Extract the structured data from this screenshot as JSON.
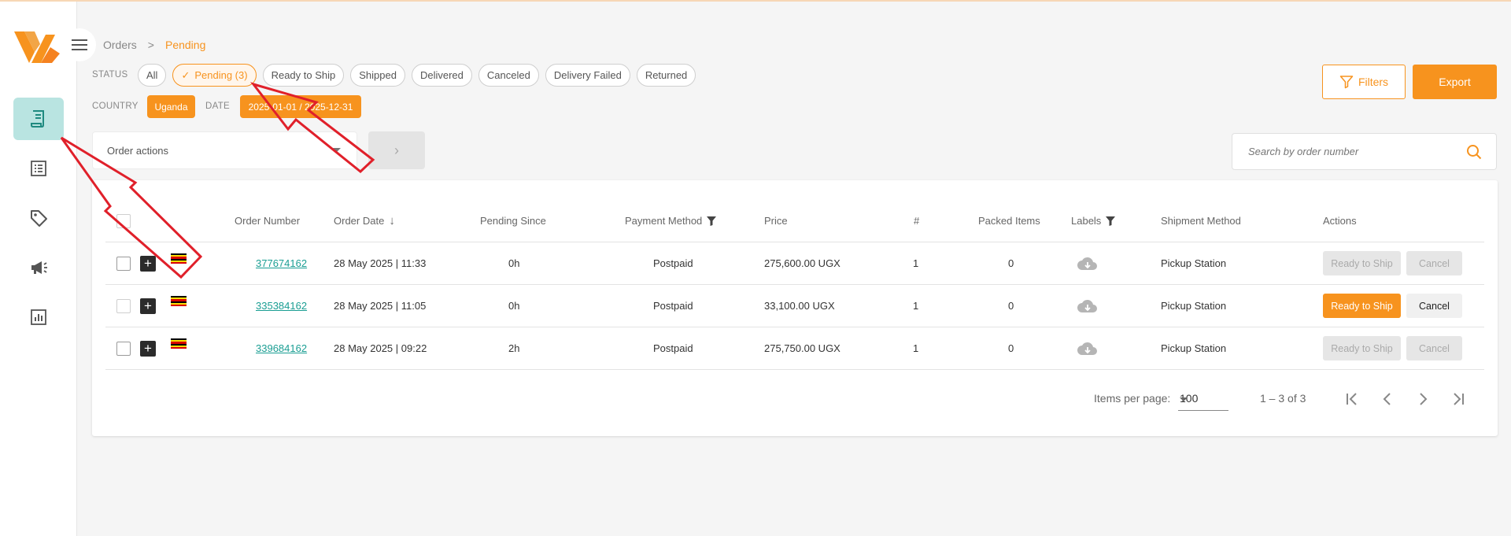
{
  "breadcrumb": {
    "root": "Orders",
    "separator": ">",
    "current": "Pending"
  },
  "filters": {
    "status_label": "STATUS",
    "statuses": [
      {
        "label": "All",
        "selected": false
      },
      {
        "label": "Pending (3)",
        "selected": true
      },
      {
        "label": "Ready to Ship",
        "selected": false
      },
      {
        "label": "Shipped",
        "selected": false
      },
      {
        "label": "Delivered",
        "selected": false
      },
      {
        "label": "Canceled",
        "selected": false
      },
      {
        "label": "Delivery Failed",
        "selected": false
      },
      {
        "label": "Returned",
        "selected": false
      }
    ],
    "country_label": "COUNTRY",
    "country_value": "Uganda",
    "date_label": "DATE",
    "date_value": "2025-01-01 / 2025-12-31"
  },
  "toolbar": {
    "filters_label": "Filters",
    "export_label": "Export"
  },
  "order_actions": {
    "placeholder": "Order actions"
  },
  "search": {
    "placeholder": "Search by order number"
  },
  "table": {
    "headers": {
      "order_number": "Order Number",
      "order_date": "Order Date",
      "pending_since": "Pending Since",
      "payment_method": "Payment Method",
      "price": "Price",
      "count": "#",
      "packed_items": "Packed Items",
      "labels": "Labels",
      "shipment_method": "Shipment Method",
      "actions": "Actions"
    },
    "rows": [
      {
        "order_number": "377674162",
        "order_date": "28 May 2025 | 11:33",
        "pending_since": "0h",
        "payment_method": "Postpaid",
        "price": "275,600.00 UGX",
        "count": "1",
        "packed_items": "0",
        "shipment_method": "Pickup Station",
        "ready_label": "Ready to Ship",
        "cancel_label": "Cancel",
        "actions_enabled": false
      },
      {
        "order_number": "335384162",
        "order_date": "28 May 2025 | 11:05",
        "pending_since": "0h",
        "payment_method": "Postpaid",
        "price": "33,100.00 UGX",
        "count": "1",
        "packed_items": "0",
        "shipment_method": "Pickup Station",
        "ready_label": "Ready to Ship",
        "cancel_label": "Cancel",
        "actions_enabled": true
      },
      {
        "order_number": "339684162",
        "order_date": "28 May 2025 | 09:22",
        "pending_since": "2h",
        "payment_method": "Postpaid",
        "price": "275,750.00 UGX",
        "count": "1",
        "packed_items": "0",
        "shipment_method": "Pickup Station",
        "ready_label": "Ready to Ship",
        "cancel_label": "Cancel",
        "actions_enabled": false
      }
    ]
  },
  "paginator": {
    "items_per_page_label": "Items per page:",
    "page_size": "100",
    "range": "1 – 3 of 3"
  },
  "sidebar": {
    "items": [
      {
        "icon": "orders-receipt-icon",
        "active": true
      },
      {
        "icon": "list-icon",
        "active": false
      },
      {
        "icon": "tag-icon",
        "active": false
      },
      {
        "icon": "megaphone-icon",
        "active": false
      },
      {
        "icon": "report-chart-icon",
        "active": false
      }
    ]
  },
  "colors": {
    "accent": "#f7931e",
    "teal": "#1a9e93",
    "active_nav": "#b9e4e1",
    "annotation": "#e0202a"
  }
}
